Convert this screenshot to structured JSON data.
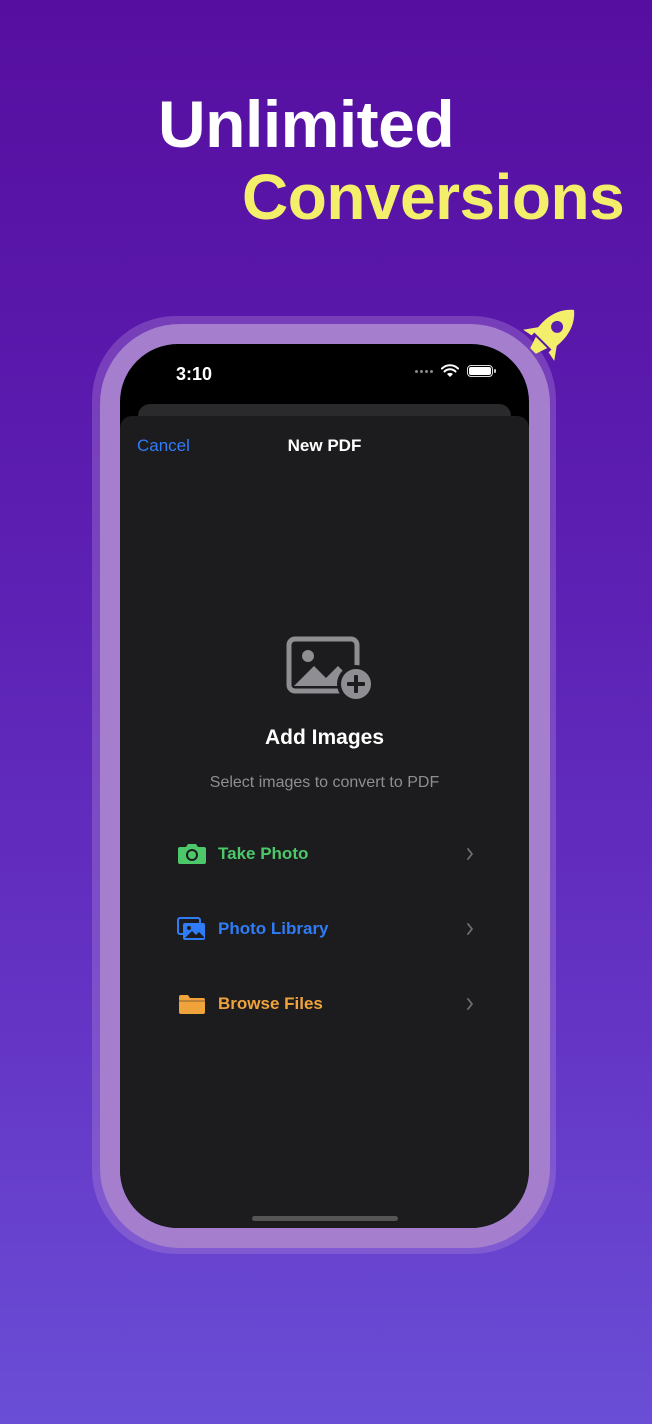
{
  "headline": {
    "line1": "Unlimited",
    "line2": "Conversions"
  },
  "status_bar": {
    "time": "3:10"
  },
  "nav": {
    "cancel_label": "Cancel",
    "title": "New PDF"
  },
  "empty_state": {
    "title": "Add Images",
    "subtitle": "Select images to convert to PDF"
  },
  "options": [
    {
      "label": "Take Photo",
      "icon": "camera-icon",
      "color": "#4cc76a"
    },
    {
      "label": "Photo Library",
      "icon": "photo-library-icon",
      "color": "#2f7cf6"
    },
    {
      "label": "Browse Files",
      "icon": "folder-icon",
      "color": "#f0a33b"
    }
  ],
  "colors": {
    "background_top": "#560ea0",
    "background_bottom": "#6a4ed6",
    "accent_yellow": "#f4ef6a",
    "phone_frame": "#a57fce"
  }
}
